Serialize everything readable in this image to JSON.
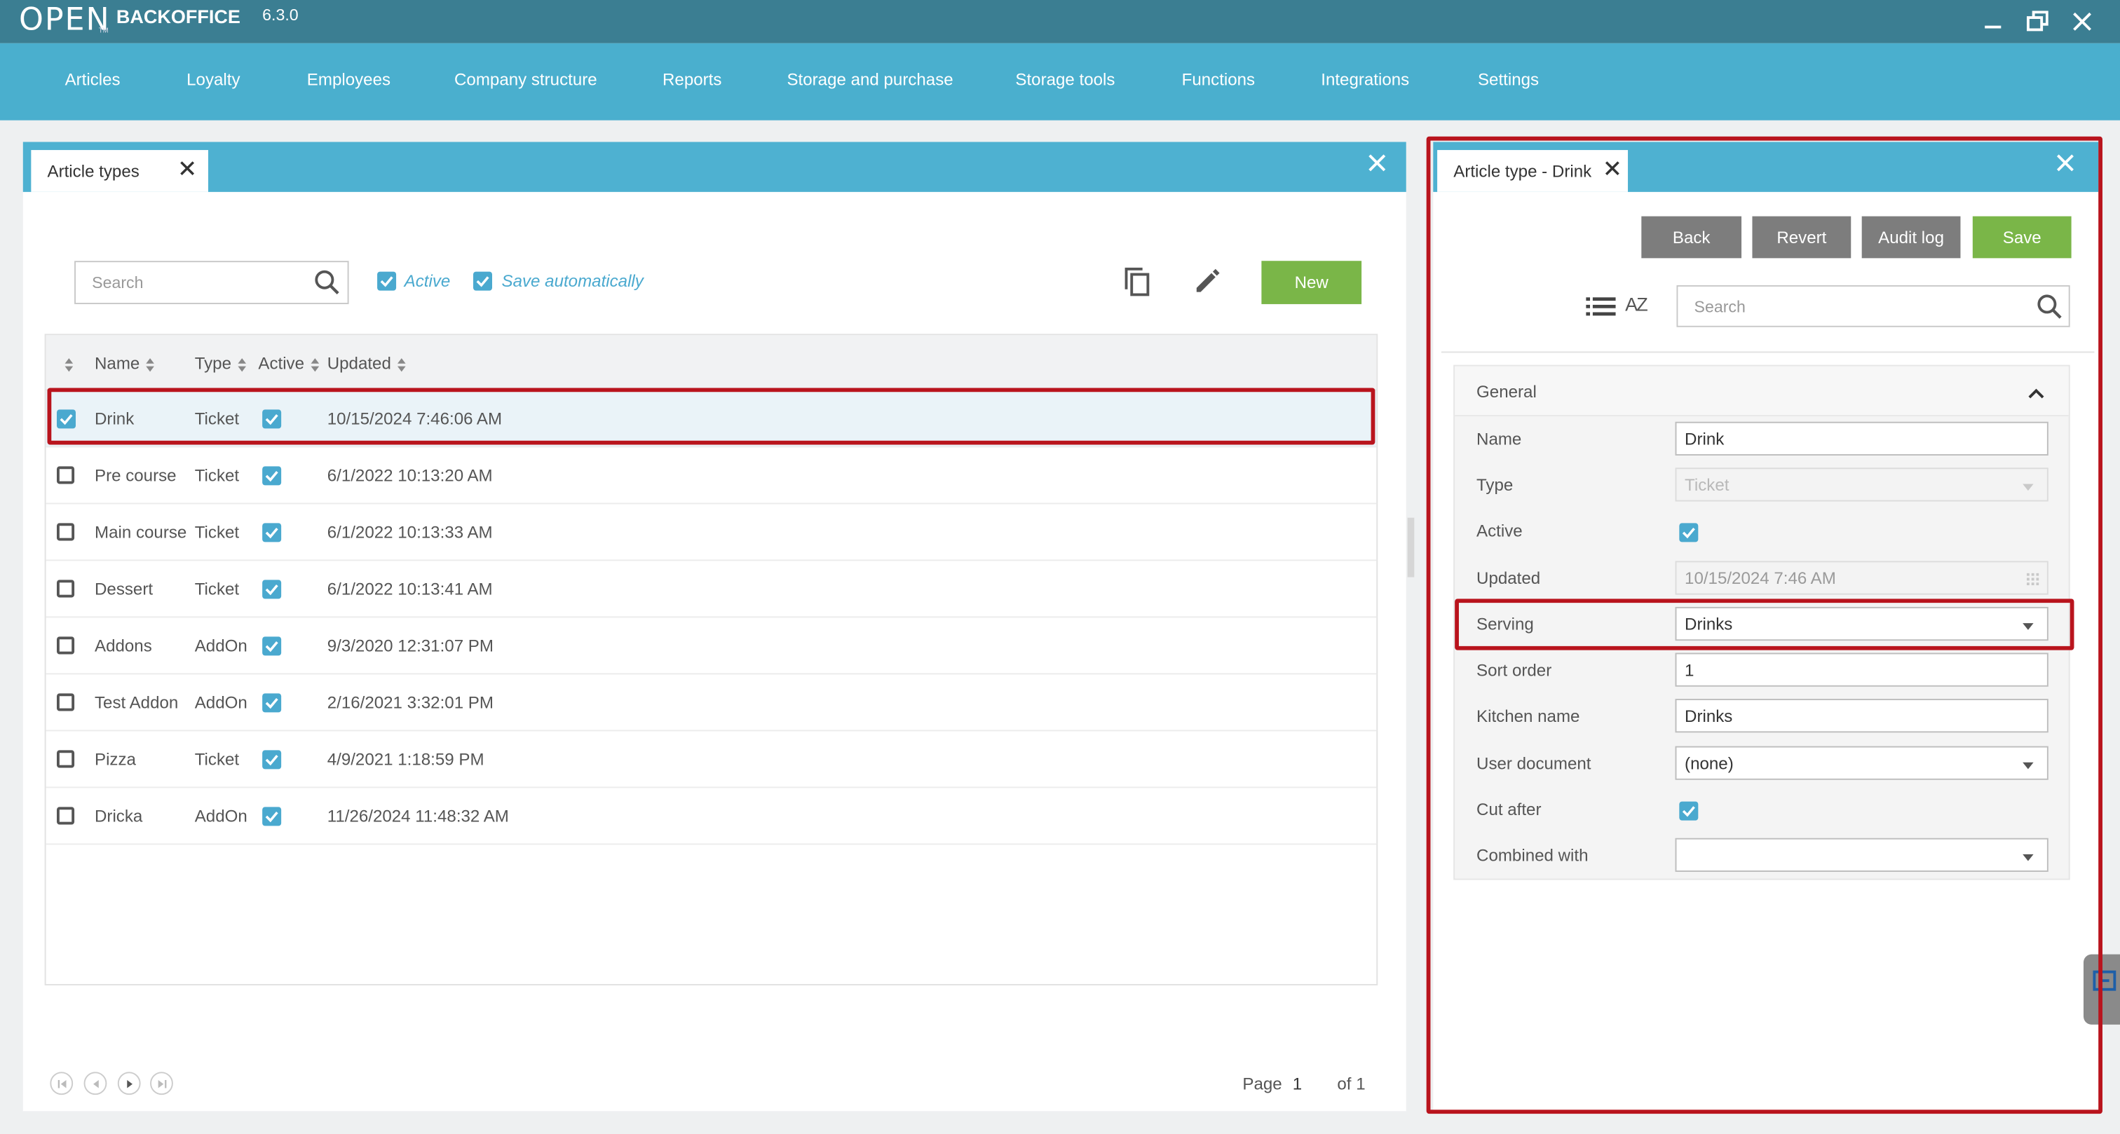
{
  "app": {
    "logo_text": "OPEN",
    "logo_sub": "TM",
    "brand": "BACKOFFICE",
    "version": "6.3.0"
  },
  "menu": [
    "Articles",
    "Loyalty",
    "Employees",
    "Company structure",
    "Reports",
    "Storage and purchase",
    "Storage tools",
    "Functions",
    "Integrations",
    "Settings"
  ],
  "list_panel": {
    "tab_label": "Article types",
    "search_placeholder": "Search",
    "active_filter_label": "Active",
    "save_auto_label": "Save automatically",
    "new_button": "New",
    "columns": {
      "name": "Name",
      "type": "Type",
      "active": "Active",
      "updated": "Updated"
    },
    "rows": [
      {
        "name": "Drink",
        "type": "Ticket",
        "active": true,
        "updated": "10/15/2024 7:46:06 AM",
        "selected": true
      },
      {
        "name": "Pre course",
        "type": "Ticket",
        "active": true,
        "updated": "6/1/2022 10:13:20 AM",
        "selected": false
      },
      {
        "name": "Main course",
        "type": "Ticket",
        "active": true,
        "updated": "6/1/2022 10:13:33 AM",
        "selected": false
      },
      {
        "name": "Dessert",
        "type": "Ticket",
        "active": true,
        "updated": "6/1/2022 10:13:41 AM",
        "selected": false
      },
      {
        "name": "Addons",
        "type": "AddOn",
        "active": true,
        "updated": "9/3/2020 12:31:07 PM",
        "selected": false
      },
      {
        "name": "Test Addon",
        "type": "AddOn",
        "active": true,
        "updated": "2/16/2021 3:32:01 PM",
        "selected": false
      },
      {
        "name": "Pizza",
        "type": "Ticket",
        "active": true,
        "updated": "4/9/2021 1:18:59 PM",
        "selected": false
      },
      {
        "name": "Dricka",
        "type": "AddOn",
        "active": true,
        "updated": "11/26/2024 11:48:32 AM",
        "selected": false
      }
    ],
    "pager": {
      "page_label": "Page",
      "page": "1",
      "of_label": "of 1"
    }
  },
  "detail_panel": {
    "tab_label": "Article type - Drink",
    "buttons": {
      "back": "Back",
      "revert": "Revert",
      "audit": "Audit log",
      "save": "Save"
    },
    "search_placeholder": "Search",
    "sort_icon_text": "AZ",
    "section_title": "General",
    "fields": {
      "name_label": "Name",
      "name_value": "Drink",
      "type_label": "Type",
      "type_value": "Ticket",
      "active_label": "Active",
      "updated_label": "Updated",
      "updated_value": "10/15/2024 7:46 AM",
      "serving_label": "Serving",
      "serving_value": "Drinks",
      "sort_label": "Sort order",
      "sort_value": "1",
      "kitchen_label": "Kitchen name",
      "kitchen_value": "Drinks",
      "userdoc_label": "User document",
      "userdoc_value": "(none)",
      "cut_label": "Cut after",
      "combined_label": "Combined with",
      "combined_value": ""
    }
  },
  "colors": {
    "titlebar": "#3b7e92",
    "menubar": "#4aafce",
    "panel_header": "#4eb1d1",
    "accent_green": "#7ab648",
    "button_gray": "#7d7d7d",
    "highlight_red": "#b9141d",
    "checkbox_blue": "#4aa9cf"
  }
}
